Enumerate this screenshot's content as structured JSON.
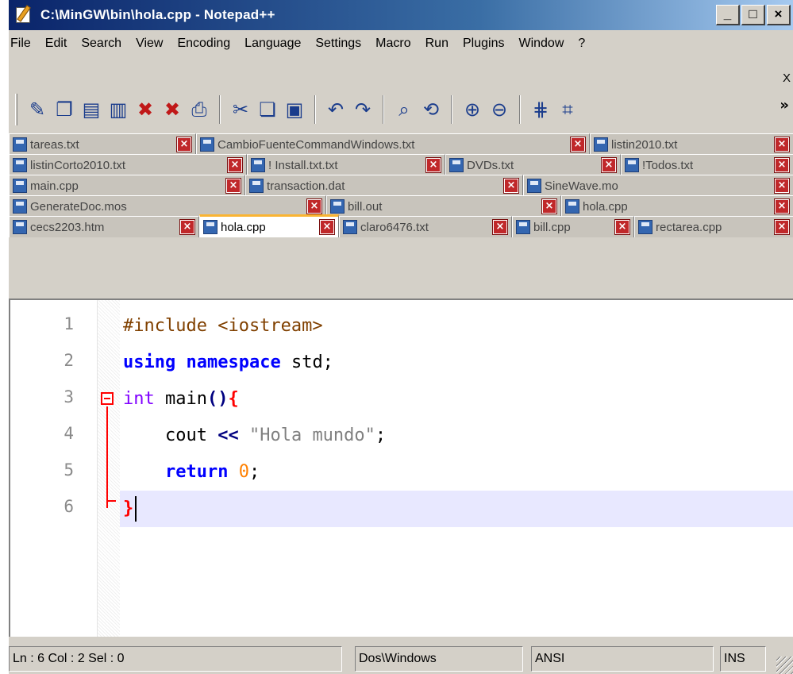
{
  "window": {
    "title": "C:\\MinGW\\bin\\hola.cpp - Notepad++",
    "buttons": {
      "minimize": "_",
      "maximize": "□",
      "close": "×"
    }
  },
  "menu": {
    "items": [
      "File",
      "Edit",
      "Search",
      "View",
      "Encoding",
      "Language",
      "Settings",
      "Macro",
      "Run",
      "Plugins",
      "Window",
      "?"
    ],
    "close_label": "X"
  },
  "toolbar": {
    "buttons": [
      {
        "name": "new-file",
        "glyph": "✎"
      },
      {
        "name": "open-file",
        "glyph": "❐"
      },
      {
        "name": "save-file",
        "glyph": "▤"
      },
      {
        "name": "save-all",
        "glyph": "▥"
      },
      {
        "name": "close-file",
        "glyph": "✖"
      },
      {
        "name": "close-all",
        "glyph": "✖"
      },
      {
        "name": "print",
        "glyph": "⎙"
      },
      {
        "name": "cut",
        "glyph": "✂"
      },
      {
        "name": "copy",
        "glyph": "❏"
      },
      {
        "name": "paste",
        "glyph": "▣"
      },
      {
        "name": "undo",
        "glyph": "↶"
      },
      {
        "name": "redo",
        "glyph": "↷"
      },
      {
        "name": "find",
        "glyph": "⌕"
      },
      {
        "name": "replace",
        "glyph": "⟲"
      },
      {
        "name": "zoom-in",
        "glyph": "⊕"
      },
      {
        "name": "zoom-out",
        "glyph": "⊖"
      },
      {
        "name": "sync-vertical",
        "glyph": "⋕"
      },
      {
        "name": "sync-horizontal",
        "glyph": "⌗"
      }
    ],
    "more": "»"
  },
  "tabs": {
    "rows": [
      [
        "tareas.txt",
        "CambioFuenteCommandWindows.txt",
        "listin2010.txt"
      ],
      [
        "listinCorto2010.txt",
        "! Install.txt.txt",
        "DVDs.txt",
        "!Todos.txt"
      ],
      [
        "main.cpp",
        "transaction.dat",
        "SineWave.mo"
      ],
      [
        "GenerateDoc.mos",
        "bill.out",
        "hola.cpp"
      ],
      [
        "cecs2203.htm",
        "hola.cpp",
        "claro6476.txt",
        "bill.cpp",
        "rectarea.cpp"
      ]
    ],
    "active": "hola.cpp",
    "close_glyph": "×"
  },
  "editor": {
    "line_numbers": [
      "1",
      "2",
      "3",
      "4",
      "5",
      "6"
    ],
    "lines": [
      {
        "tokens": [
          {
            "c": "pre",
            "t": "#include <iostream>"
          }
        ]
      },
      {
        "tokens": [
          {
            "c": "kw",
            "t": "using"
          },
          {
            "c": "",
            "t": " "
          },
          {
            "c": "kw",
            "t": "namespace"
          },
          {
            "c": "",
            "t": " std;"
          }
        ]
      },
      {
        "tokens": [
          {
            "c": "type",
            "t": "int"
          },
          {
            "c": "",
            "t": " main"
          },
          {
            "c": "op",
            "t": "()"
          },
          {
            "c": "brace",
            "t": "{"
          }
        ]
      },
      {
        "tokens": [
          {
            "c": "",
            "t": "    cout "
          },
          {
            "c": "op",
            "t": "<<"
          },
          {
            "c": "",
            "t": " "
          },
          {
            "c": "str",
            "t": "\"Hola mundo\""
          },
          {
            "c": "",
            "t": ";"
          }
        ]
      },
      {
        "tokens": [
          {
            "c": "",
            "t": "    "
          },
          {
            "c": "kw",
            "t": "return"
          },
          {
            "c": "",
            "t": " "
          },
          {
            "c": "num",
            "t": "0"
          },
          {
            "c": "",
            "t": ";"
          }
        ]
      },
      {
        "tokens": [
          {
            "c": "brace",
            "t": "}"
          }
        ]
      }
    ],
    "current_line": 6
  },
  "statusbar": {
    "position": "Ln : 6    Col : 2    Sel : 0",
    "eol": "Dos\\Windows",
    "encoding": "ANSI",
    "mode": "INS"
  }
}
